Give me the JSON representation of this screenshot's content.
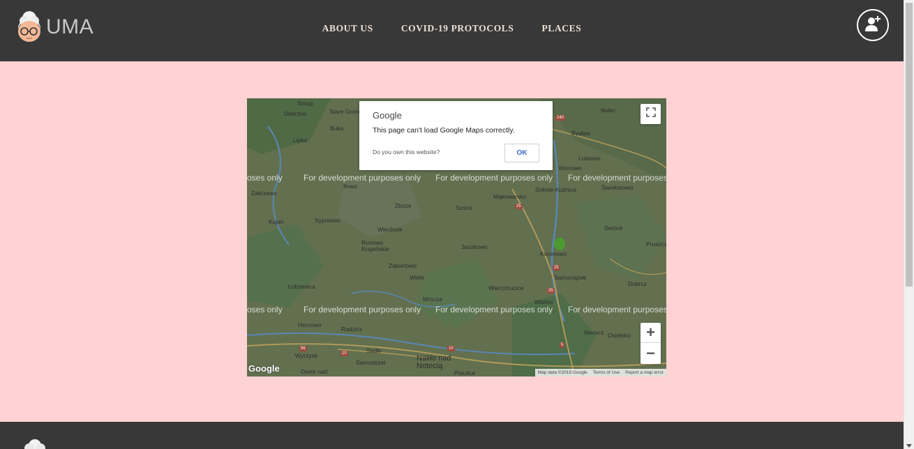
{
  "header": {
    "brand": "UMA",
    "nav": [
      "ABOUT US",
      "COVID-19 PROTOCOLS",
      "PLACES"
    ],
    "icons": {
      "logo": "grandma-logo-icon",
      "user": "add-user-icon"
    }
  },
  "map": {
    "dialog": {
      "logo": "Google",
      "message": "This page can't load Google Maps correctly.",
      "question": "Do you own this website?",
      "ok": "OK"
    },
    "watermark": "For development purposes only",
    "watermark_partial_left": "oses only",
    "watermark_partial_right": "For development purposes o",
    "places": [
      "Smug",
      "Debrzno",
      "Stare Gronowo",
      "Buka",
      "Lipka",
      "Iłowo",
      "Zakrzewo",
      "Zboże",
      "Sośno",
      "Mąkowarsko",
      "Kujan",
      "Sypniewo",
      "Więcbork",
      "Runowo Krajeńskie",
      "Jaszkowo",
      "Koronowo",
      "Zabartowo",
      "Więle",
      "Samociążek",
      "Łobżenica",
      "Mrocza",
      "Wierzchucice",
      "Wtelno",
      "Hercowo",
      "Radzicz",
      "Sadki",
      "Wyrzysk",
      "Samostrzel",
      "Nakło nad Notecią",
      "Potulice",
      "Osiek nad",
      "Iłwiec",
      "Bysław",
      "Lubiewo",
      "Klonowo",
      "Sokole-Kuźnica",
      "Świekatowo",
      "Serock",
      "Pruszcz",
      "Dobrcz",
      "Niemcz",
      "Osielsko"
    ],
    "road_numbers": [
      "240",
      "25",
      "25",
      "25",
      "56",
      "10",
      "10",
      "5"
    ],
    "attribution": [
      "Map data ©2019 Google",
      "Terms of Use",
      "Report a map error"
    ],
    "google_mark": "Google",
    "controls": {
      "fullscreen": "fullscreen-icon",
      "zoom_in": "+",
      "zoom_out": "−"
    }
  },
  "colors": {
    "page_bg": "#ffd2d3",
    "header_bg": "#383838",
    "nav_text": "#e9e0d6"
  }
}
